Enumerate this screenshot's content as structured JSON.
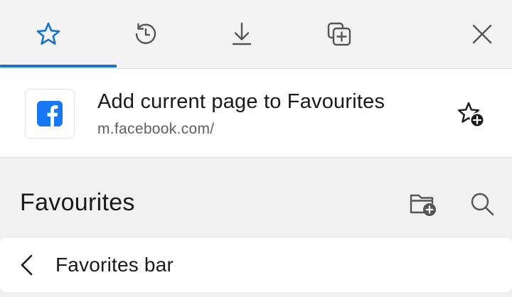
{
  "tabs": [
    {
      "id": "favourites",
      "icon": "star-icon",
      "selected": true
    },
    {
      "id": "history",
      "icon": "history-icon",
      "selected": false
    },
    {
      "id": "downloads",
      "icon": "download-icon",
      "selected": false
    },
    {
      "id": "collections",
      "icon": "collections-icon",
      "selected": false
    }
  ],
  "close_icon": "close-icon",
  "add_current": {
    "title": "Add current page to Favourites",
    "url": "m.facebook.com/",
    "site_icon": "facebook-logo",
    "action_icon": "add-star-icon"
  },
  "favourites": {
    "title": "Favourites",
    "new_folder_icon": "new-folder-icon",
    "search_icon": "search-icon",
    "folder": {
      "label": "Favorites bar",
      "icon": "chevron-left-icon"
    }
  },
  "colors": {
    "accent": "#1a73c8",
    "facebook_blue": "#1877f2",
    "background": "#f1f1f1",
    "card": "#ffffff"
  }
}
